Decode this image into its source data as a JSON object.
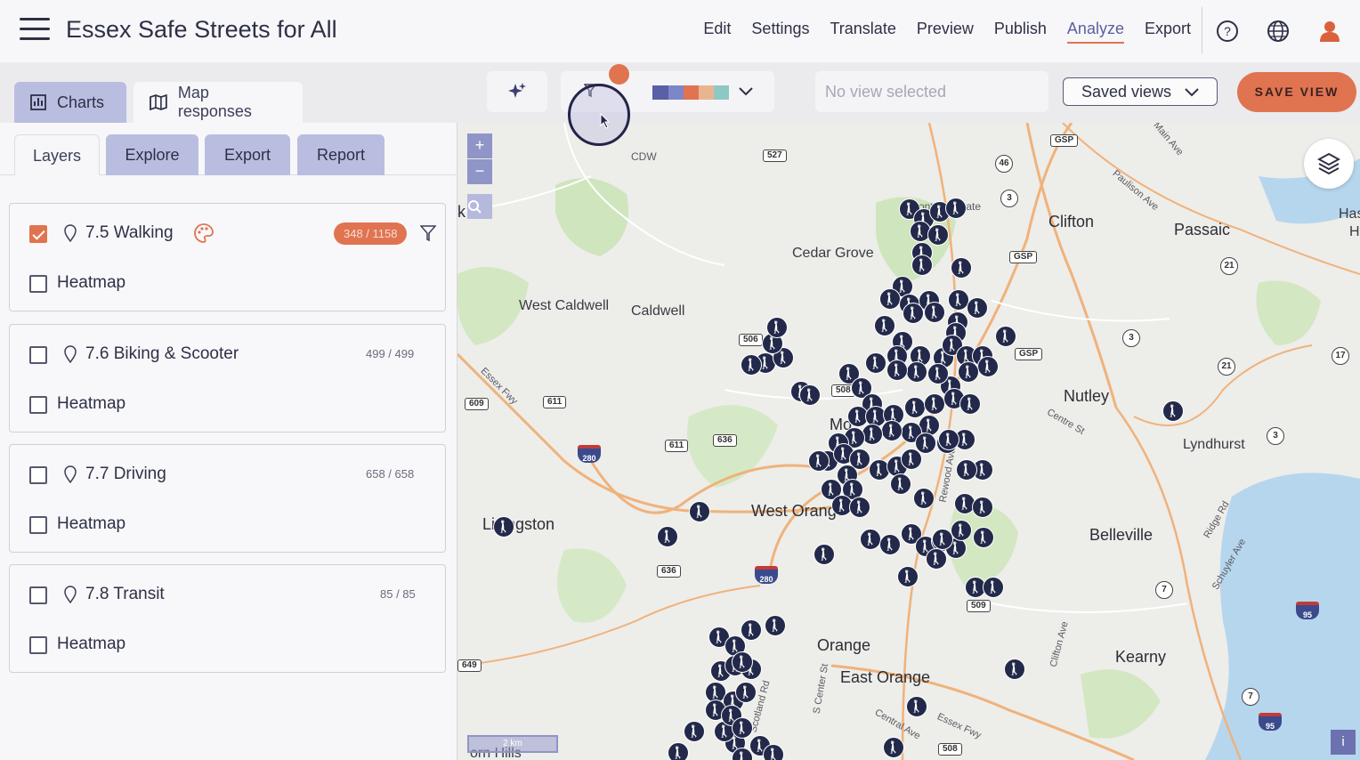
{
  "header": {
    "title": "Essex Safe Streets for All",
    "nav": [
      "Edit",
      "Settings",
      "Translate",
      "Preview",
      "Publish",
      "Analyze",
      "Export"
    ],
    "active_nav": "Analyze",
    "icons": [
      "help-icon",
      "globe-icon",
      "user-icon"
    ]
  },
  "toolbar": {
    "tabs": [
      "Charts",
      "Map responses"
    ],
    "view_placeholder": "No view selected",
    "saved_views_label": "Saved views",
    "save_view_label": "SAVE VIEW",
    "palette_colors": [
      "#5a5fa8",
      "#7d86c9",
      "#e07450",
      "#e8b68e",
      "#8ec8c2"
    ]
  },
  "panel": {
    "tabs": [
      "Layers",
      "Explore",
      "Export",
      "Report"
    ],
    "layers": [
      {
        "label": "7.5 Walking",
        "count": "348 / 1158",
        "checked": true,
        "heatmap": "Heatmap"
      },
      {
        "label": "7.6 Biking & Scooter",
        "count": "499 / 499",
        "checked": false,
        "heatmap": "Heatmap"
      },
      {
        "label": "7.7 Driving",
        "count": "658 / 658",
        "checked": false,
        "heatmap": "Heatmap"
      },
      {
        "label": "7.8 Transit",
        "count": "85 / 85",
        "checked": false,
        "heatmap": "Heatmap"
      }
    ]
  },
  "map": {
    "places": [
      "Clifton",
      "Passaic",
      "Cedar Grove",
      "West Caldwell",
      "Caldwell",
      "Nutley",
      "Lyndhurst",
      "Belleville",
      "West Orange",
      "Orange",
      "East Orange",
      "Kearny",
      "Livingston",
      "Montclair State",
      "CDW",
      "Has",
      "H",
      "Mo",
      "k"
    ],
    "roads": [
      "Main Ave",
      "Paulison Ave",
      "Essex Fwy",
      "Centre St",
      "Ridge Rd",
      "Schuyler Ave",
      "Clifton Ave",
      "S Center St",
      "Central Ave",
      "Essex Fwy",
      "Scotland Rd",
      "Rewood Ave"
    ],
    "shields": [
      "527",
      "506",
      "508",
      "611",
      "609",
      "611",
      "636",
      "636",
      "509",
      "508",
      "649",
      "GSP",
      "GSP",
      "GSP"
    ],
    "circle_shields": [
      "46",
      "3",
      "21",
      "3",
      "21",
      "17",
      "3",
      "7",
      "7"
    ],
    "interstates": [
      "280",
      "280",
      "95",
      "95"
    ],
    "zoom_in": "+",
    "zoom_out": "−",
    "scale": "2 km",
    "info": "i",
    "bottom_partial": "orn Hills"
  }
}
